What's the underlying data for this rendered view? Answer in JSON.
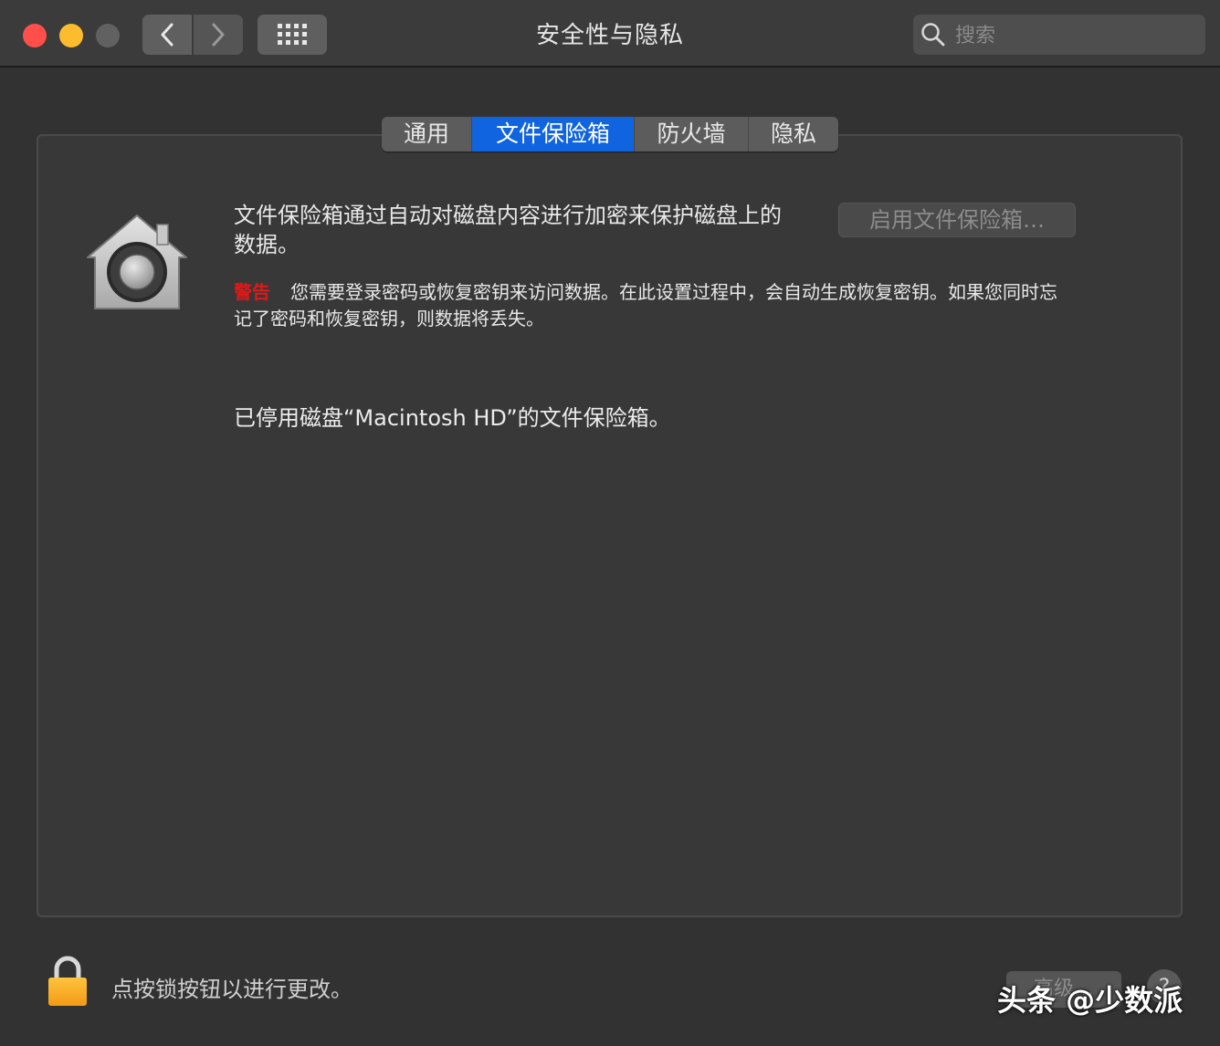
{
  "window": {
    "title": "安全性与隐私"
  },
  "toolbar": {
    "back_icon": "chevron-left-icon",
    "forward_icon": "chevron-right-icon",
    "grid_icon": "grid-icon"
  },
  "search": {
    "placeholder": "搜索",
    "value": ""
  },
  "tabs": [
    {
      "label": "通用",
      "selected": false
    },
    {
      "label": "文件保险箱",
      "selected": true
    },
    {
      "label": "防火墙",
      "selected": false
    },
    {
      "label": "隐私",
      "selected": false
    }
  ],
  "filevault": {
    "description": "文件保险箱通过自动对磁盘内容进行加密来保护磁盘上的数据。",
    "enable_button": "启用文件保险箱…",
    "warning_label": "警告",
    "warning_text": "您需要登录密码或恢复密钥来访问数据。在此设置过程中，会自动生成恢复密钥。如果您同时忘记了密码和恢复密钥，则数据将丢失。",
    "status": "已停用磁盘“Macintosh HD”的文件保险箱。"
  },
  "footer": {
    "lock_text": "点按锁按钮以进行更改。",
    "advanced_button": "高级…",
    "help_button": "?"
  },
  "watermark": "头条 @少数派",
  "colors": {
    "accent": "#1064e0",
    "warning": "#e01818",
    "close": "#fe4f4b",
    "minimize": "#fdbc2e",
    "lock": "#f5a623"
  }
}
